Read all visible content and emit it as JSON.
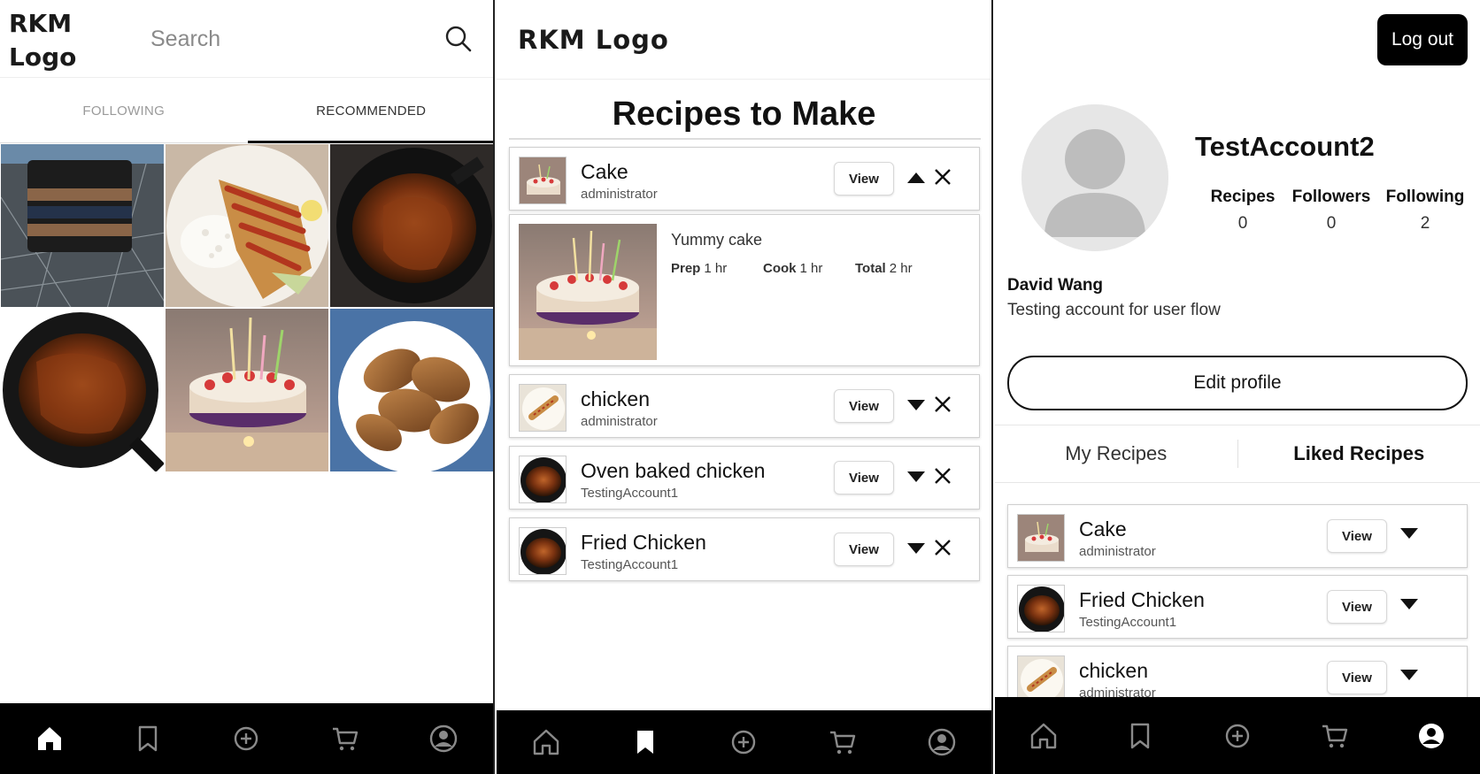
{
  "colors": {
    "nav_bg": "#000000",
    "nav_icon": "#888888",
    "nav_icon_active": "#ffffff",
    "accent": "#111111"
  },
  "screen1": {
    "logo_line1": "RKM",
    "logo_line2": "Logo",
    "search_placeholder": "Search",
    "tabs": [
      {
        "label": "FOLLOWING",
        "active": false
      },
      {
        "label": "RECOMMENDED",
        "active": true
      }
    ],
    "grid": [
      {
        "name": "wallet-photo"
      },
      {
        "name": "chicken-katsu-photo"
      },
      {
        "name": "roast-chicken-photo"
      },
      {
        "name": "roast-chicken-photo"
      },
      {
        "name": "cake-photo"
      },
      {
        "name": "fried-chicken-photo"
      }
    ],
    "nav_active": "home"
  },
  "screen2": {
    "logo": "RKM Logo",
    "title": "Recipes to Make",
    "recipes": [
      {
        "name": "Cake",
        "author": "administrator",
        "view": "View",
        "expanded": true
      },
      {
        "name": "chicken",
        "author": "administrator",
        "view": "View",
        "expanded": false
      },
      {
        "name": "Oven baked chicken",
        "author": "TestingAccount1",
        "view": "View",
        "expanded": false
      },
      {
        "name": "Fried Chicken",
        "author": "TestingAccount1",
        "view": "View",
        "expanded": false
      }
    ],
    "detail": {
      "description": "Yummy cake",
      "prep_label": "Prep",
      "prep_value": "1 hr",
      "cook_label": "Cook",
      "cook_value": "1 hr",
      "total_label": "Total",
      "total_value": "2 hr"
    },
    "nav_active": "bookmark"
  },
  "screen3": {
    "logout": "Log out",
    "username": "TestAccount2",
    "stats": [
      {
        "label": "Recipes",
        "value": "0"
      },
      {
        "label": "Followers",
        "value": "0"
      },
      {
        "label": "Following",
        "value": "2"
      }
    ],
    "full_name": "David Wang",
    "bio": "Testing account for user flow",
    "edit_profile": "Edit profile",
    "tabs": [
      {
        "label": "My Recipes",
        "active": false
      },
      {
        "label": "Liked Recipes",
        "active": true
      }
    ],
    "liked": [
      {
        "name": "Cake",
        "author": "administrator",
        "view": "View"
      },
      {
        "name": "Fried Chicken",
        "author": "TestingAccount1",
        "view": "View"
      },
      {
        "name": "chicken",
        "author": "administrator",
        "view": "View"
      }
    ],
    "nav_active": "profile"
  }
}
